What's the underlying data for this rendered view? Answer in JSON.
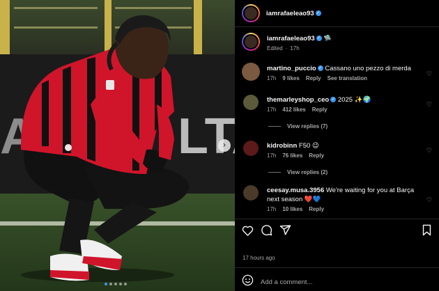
{
  "post": {
    "username": "iamrafaeleao93",
    "caption_emoji": "🛸",
    "edited_label": "Edited",
    "caption_time": "17h",
    "time_ago": "17 hours ago",
    "add_comment_placeholder": "Add a comment..."
  },
  "comments": [
    {
      "user": "martino_puccio",
      "verified": true,
      "text": "Cassano uno pezzo di merda",
      "time": "17h",
      "likes": "9 likes",
      "reply": "Reply",
      "extra": "See translation"
    },
    {
      "user": "themarleyshop_ceo",
      "verified": true,
      "text": "2025 ✨🌍",
      "time": "17h",
      "likes": "412 likes",
      "reply": "Reply",
      "view_replies": "View replies (7)"
    },
    {
      "user": "kidrobinn",
      "verified": false,
      "text": "F50 😉",
      "time": "17h",
      "likes": "76 likes",
      "reply": "Reply",
      "view_replies": "View replies (2)"
    },
    {
      "user": "ceesay.musa.3956",
      "verified": false,
      "text": "We're waiting for you at Barça next season ❤️💙",
      "time": "17h",
      "likes": "10 likes",
      "reply": "Reply"
    }
  ],
  "colors": {
    "accent": "#3897f0",
    "kit_red": "#d0152b",
    "background": "#000000"
  },
  "icons": [
    "heart-icon",
    "comment-icon",
    "share-icon",
    "bookmark-icon",
    "emoji-icon",
    "next-arrow-icon"
  ],
  "carousel": {
    "slides": 5,
    "active": 1
  }
}
